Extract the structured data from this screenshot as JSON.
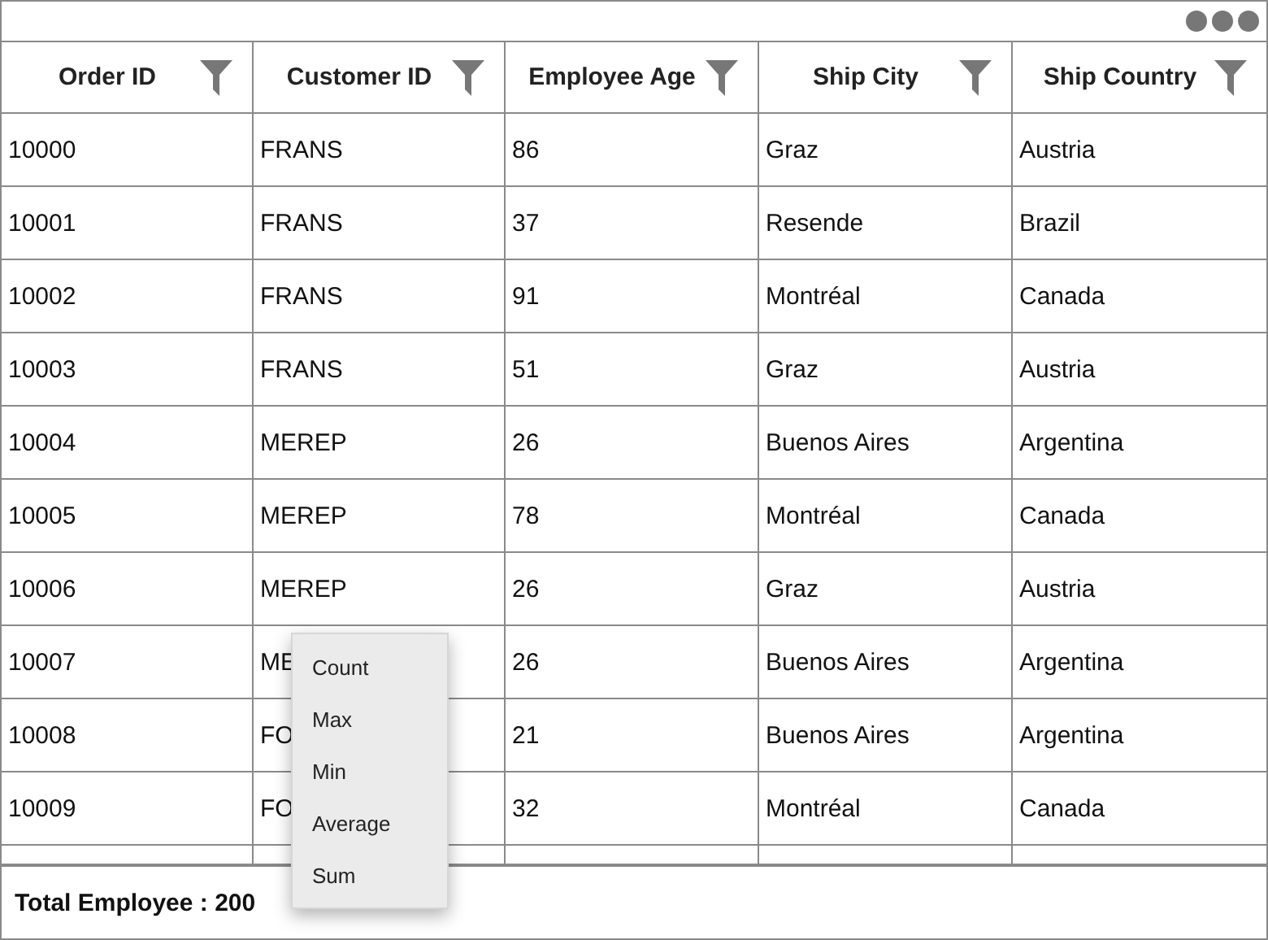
{
  "table": {
    "columns": [
      "Order ID",
      "Customer ID",
      "Employee Age",
      "Ship City",
      "Ship Country"
    ],
    "rows": [
      [
        "10000",
        "FRANS",
        "86",
        "Graz",
        "Austria"
      ],
      [
        "10001",
        "FRANS",
        "37",
        "Resende",
        "Brazil"
      ],
      [
        "10002",
        "FRANS",
        "91",
        "Montréal",
        "Canada"
      ],
      [
        "10003",
        "FRANS",
        "51",
        "Graz",
        "Austria"
      ],
      [
        "10004",
        "MEREP",
        "26",
        "Buenos Aires",
        "Argentina"
      ],
      [
        "10005",
        "MEREP",
        "78",
        "Montréal",
        "Canada"
      ],
      [
        "10006",
        "MEREP",
        "26",
        "Graz",
        "Austria"
      ],
      [
        "10007",
        "ME",
        "26",
        "Buenos Aires",
        "Argentina"
      ],
      [
        "10008",
        "FO",
        "21",
        "Buenos Aires",
        "Argentina"
      ],
      [
        "10009",
        "FO",
        "32",
        "Montréal",
        "Canada"
      ]
    ]
  },
  "summary": "Total Employee : 200",
  "context_menu": {
    "items": [
      "Count",
      "Max",
      "Min",
      "Average",
      "Sum"
    ]
  }
}
